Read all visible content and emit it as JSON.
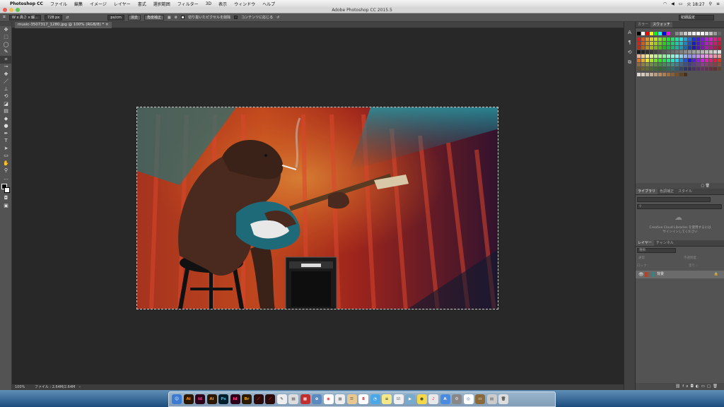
{
  "menubar": {
    "app_name": "Photoshop CC",
    "items": [
      "ファイル",
      "編集",
      "イメージ",
      "レイヤー",
      "書式",
      "選択範囲",
      "フィルター",
      "3D",
      "表示",
      "ウィンドウ",
      "ヘルプ"
    ],
    "clock": "火 18:27"
  },
  "window": {
    "title": "Adobe Photoshop CC 2015.5"
  },
  "options": {
    "ratio": "W x 高さ x 解...",
    "width_value": "728 px",
    "unit": "px/cm",
    "clear_label": "消去",
    "straighten_label": "角度補正",
    "delete_cropped_label": "切り抜いたピクセルを削除",
    "content_aware_label": "コンテンツに応じる",
    "workspace": "初期設定"
  },
  "document": {
    "tab_label": "music-3507317_1280.jpg @ 100% (RGB/8) *",
    "zoom": "100%",
    "file_info": "ファイル : 2.64M/2.64M"
  },
  "panels": {
    "color_tabs": [
      "カラー",
      "スウォッチ"
    ],
    "library_tabs": [
      "ライブラリ",
      "色調補正",
      "スタイル"
    ],
    "library_msg": "Creative Cloud Libraries を使用するにはサインインしてください",
    "layer_tabs": [
      "レイヤー",
      "チャンネル"
    ],
    "layer_kind": "種類",
    "blend_mode": "通常",
    "opacity_label": "不透明度 :",
    "lock_label": "ロック :",
    "fill_label": "塗り :",
    "layer_name": "背景"
  },
  "tools": [
    "move",
    "marquee",
    "lasso",
    "quick-select",
    "crop",
    "eyedropper",
    "healing",
    "brush",
    "stamp",
    "history-brush",
    "eraser",
    "gradient",
    "blur",
    "dodge",
    "pen",
    "type",
    "path-select",
    "rectangle",
    "hand",
    "zoom",
    "more"
  ],
  "dock": [
    "Finder",
    "Ai",
    "Id",
    "Ai",
    "Ps",
    "Id",
    "Br",
    "Ac",
    "Ac"
  ]
}
